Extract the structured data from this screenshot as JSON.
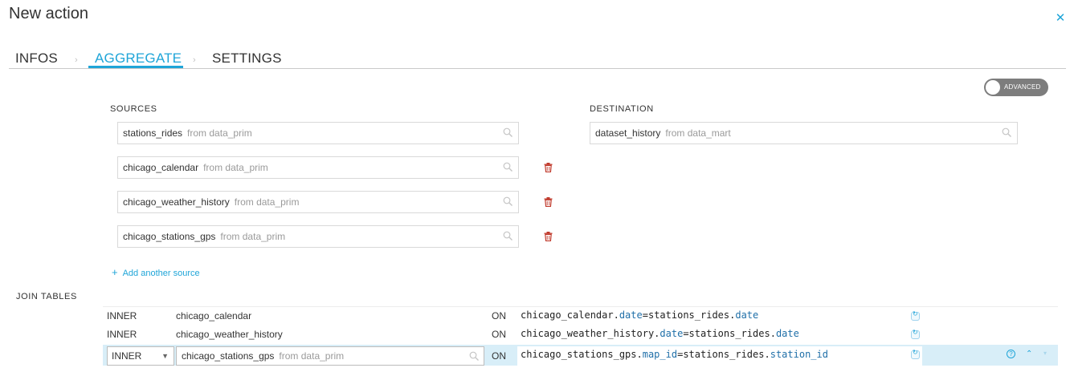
{
  "header": {
    "title": "New action",
    "close_icon": "close-icon"
  },
  "tabs": [
    {
      "label": "INFOS",
      "active": false
    },
    {
      "label": "AGGREGATE",
      "active": true
    },
    {
      "label": "SETTINGS",
      "active": false
    }
  ],
  "advanced_toggle": {
    "label": "ADVANCED",
    "state": "off"
  },
  "sources": {
    "label": "SOURCES",
    "items": [
      {
        "name": "stations_rides",
        "from": "from data_prim"
      },
      {
        "name": "chicago_calendar",
        "from": "from data_prim"
      },
      {
        "name": "chicago_weather_history",
        "from": "from data_prim"
      },
      {
        "name": "chicago_stations_gps",
        "from": "from data_prim"
      }
    ],
    "add_label": "Add another source"
  },
  "destination": {
    "label": "DESTINATION",
    "name": "dataset_history",
    "from": "from data_mart"
  },
  "joins": {
    "label": "JOIN TABLES",
    "on_label": "ON",
    "rows": [
      {
        "type": "INNER",
        "table": "chicago_calendar",
        "left_table": "chicago_calendar",
        "left_col": "date",
        "right_table": "stations_rides",
        "right_col": "date"
      },
      {
        "type": "INNER",
        "table": "chicago_weather_history",
        "left_table": "chicago_weather_history",
        "left_col": "date",
        "right_table": "stations_rides",
        "right_col": "date"
      },
      {
        "type": "INNER",
        "table": "chicago_stations_gps",
        "from": "from data_prim",
        "left_table": "chicago_stations_gps",
        "left_col": "map_id",
        "right_table": "stations_rides",
        "right_col": "station_id"
      }
    ]
  },
  "colors": {
    "accent": "#1fa5d8",
    "delete": "#c0392b",
    "active_row": "#d8eef8",
    "toggle_off": "#7d7d7d"
  }
}
